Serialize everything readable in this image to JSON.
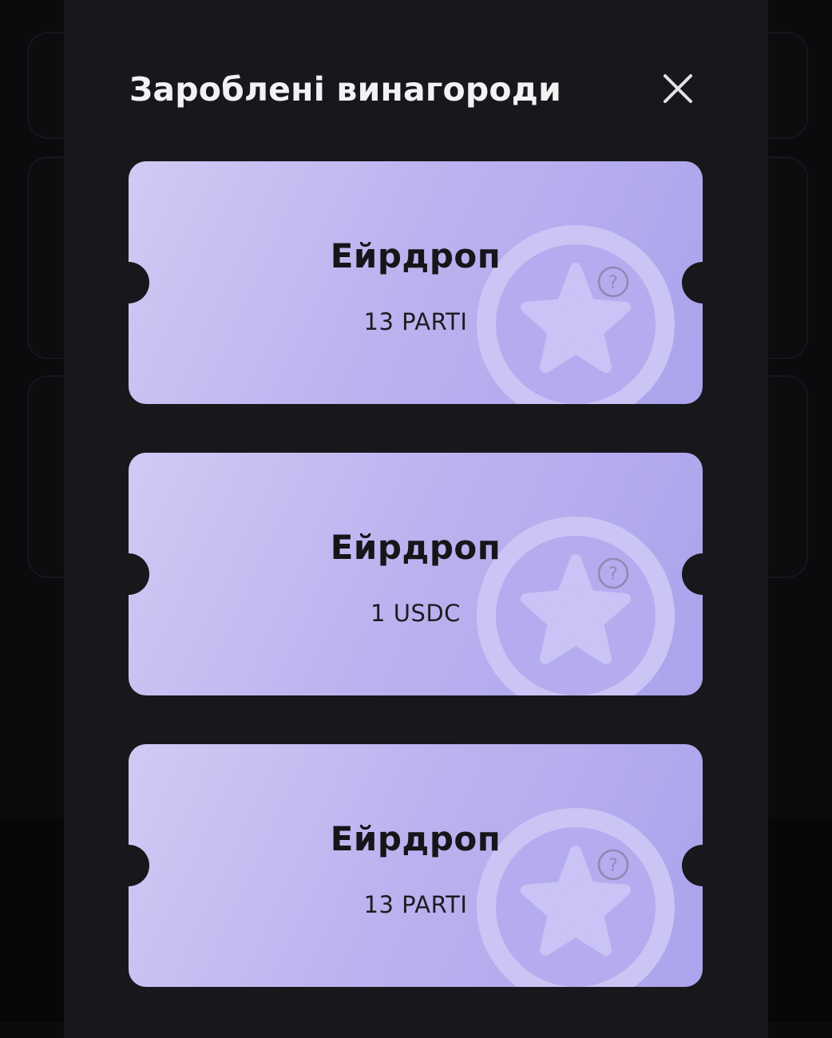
{
  "modal": {
    "title": "Зароблені винагороди",
    "close_icon": "close-icon"
  },
  "rewards": [
    {
      "name": "Ейрдроп",
      "amount": "13 PARTI",
      "help_icon": "question-circle-icon",
      "badge_icon": "star-icon"
    },
    {
      "name": "Ейрдроп",
      "amount": "1 USDC",
      "help_icon": "question-circle-icon",
      "badge_icon": "star-icon"
    },
    {
      "name": "Ейрдроп",
      "amount": "13 PARTI",
      "help_icon": "question-circle-icon",
      "badge_icon": "star-icon"
    }
  ],
  "colors": {
    "background": "#0b0b0d",
    "modal": "#18181c",
    "ticket_start": "#d2c9f4",
    "ticket_end": "#aba3ec",
    "title_text": "#f2f2f4",
    "ticket_text": "#16161a"
  }
}
